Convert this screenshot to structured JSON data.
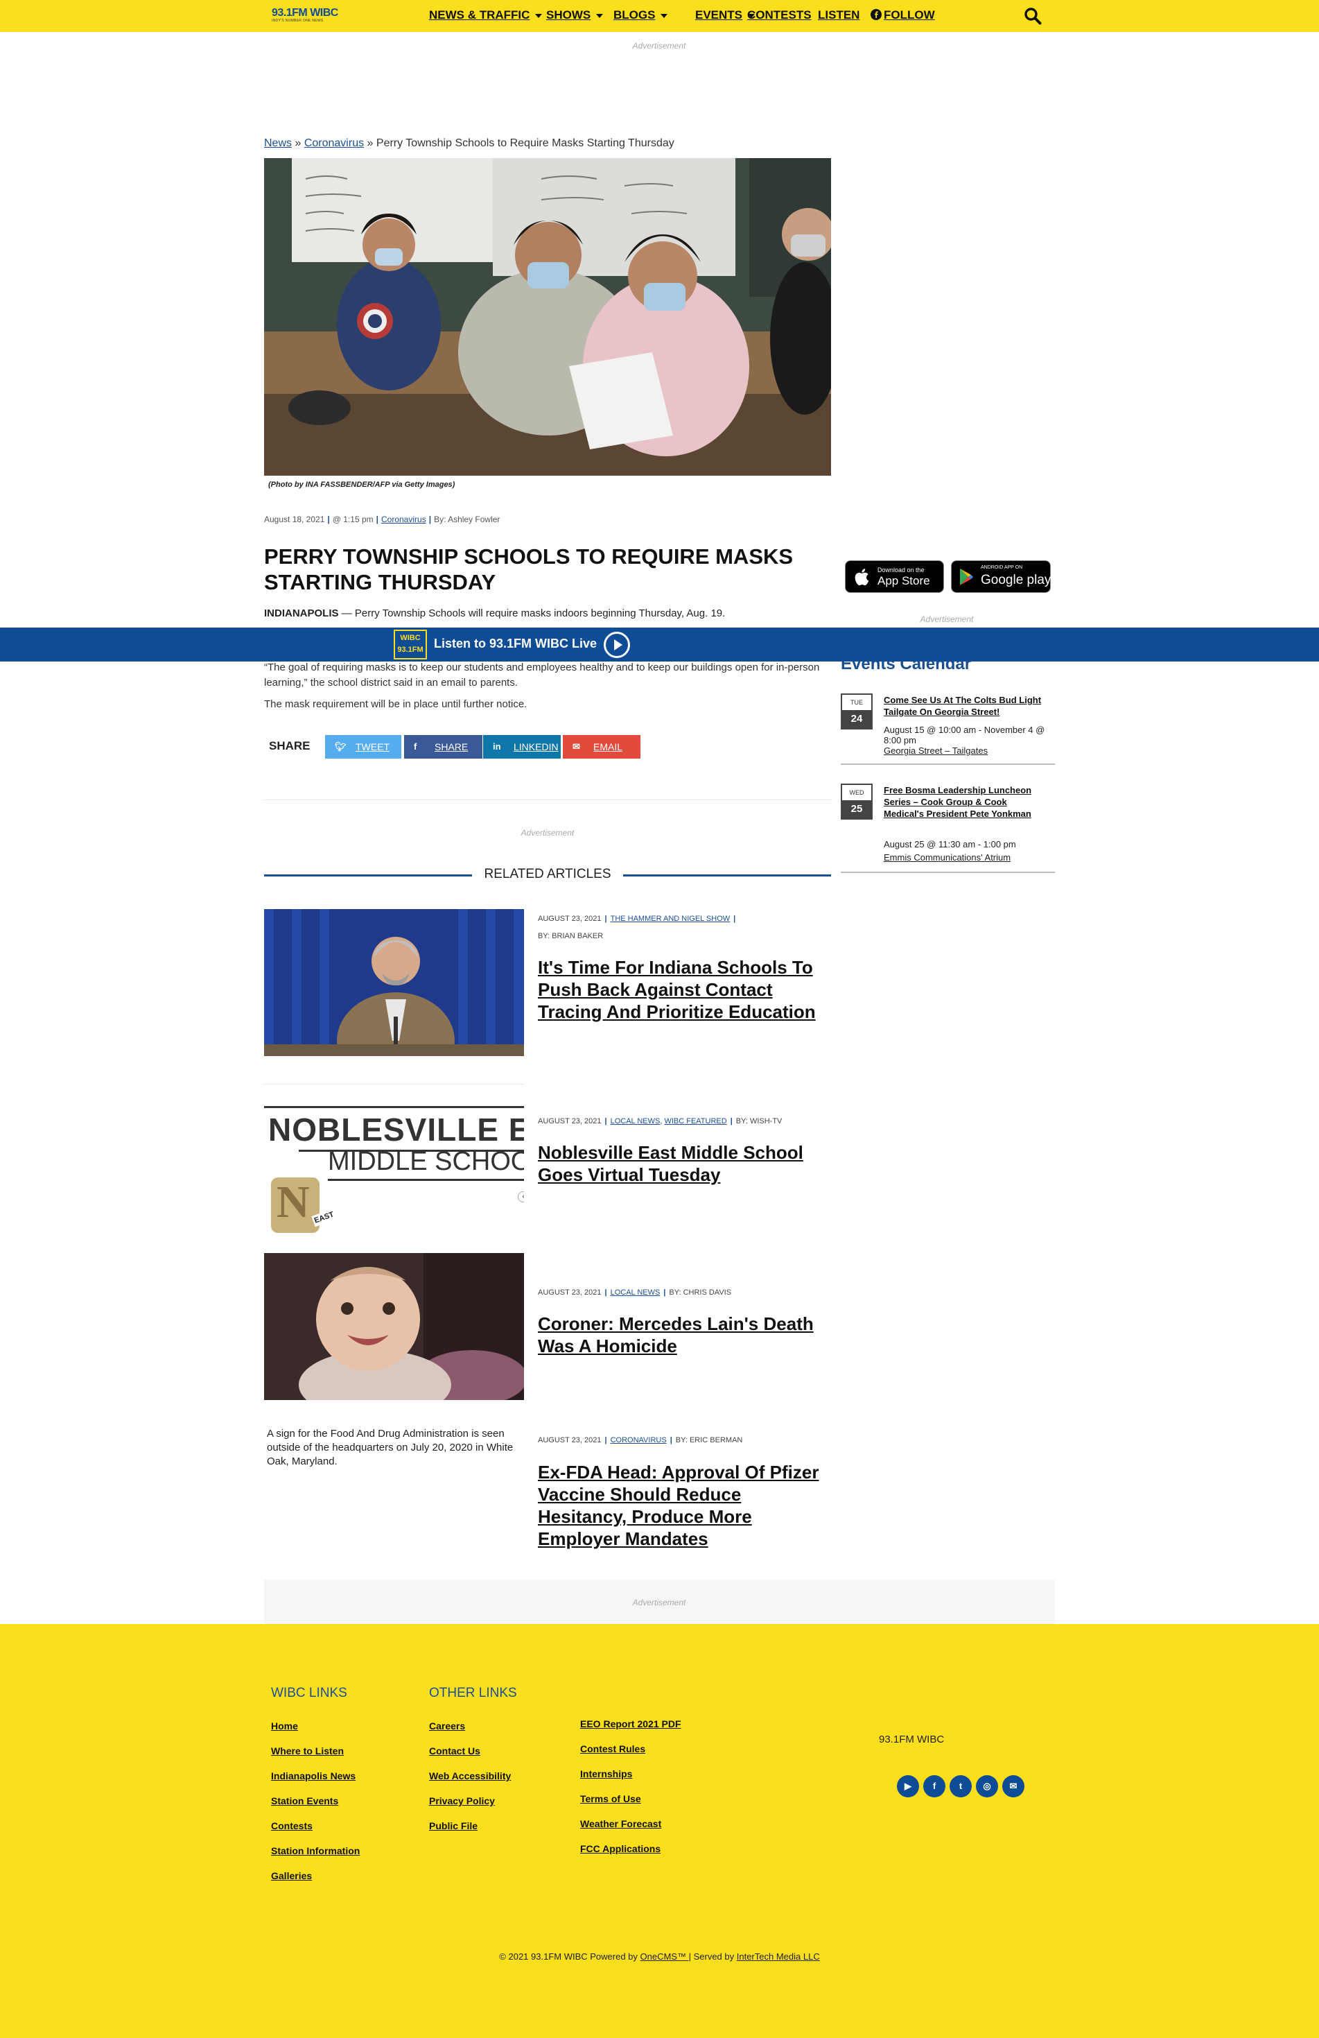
{
  "colors": {
    "brand_yellow": "#fbde1c",
    "brand_blue": "#0e4c96",
    "link_blue": "#1b4f93",
    "tweet": "#55acee",
    "share": "#3b5998",
    "linkedin": "#0e76a8",
    "email": "#e24b3c"
  },
  "header": {
    "logo_text": "93.1FM WIBC",
    "logo_tagline": "Indy's Number One News",
    "nav": [
      {
        "label": "NEWS & TRAFFIC",
        "dropdown": true
      },
      {
        "label": "SHOWS",
        "dropdown": true
      },
      {
        "label": "BLOGS",
        "dropdown": true
      },
      {
        "label": "EVENTS",
        "dropdown": true
      },
      {
        "label": "CONTESTS",
        "dropdown": false
      },
      {
        "label": "LISTEN",
        "dropdown": false
      },
      {
        "label": "FOLLOW",
        "dropdown": false,
        "icon": "facebook-icon"
      }
    ],
    "search_icon": "search-icon"
  },
  "ads": {
    "label": "Advertisement"
  },
  "breadcrumb": {
    "items": [
      "News",
      "Coronavirus"
    ],
    "current": "Perry Township Schools to Require Masks Starting Thursday",
    "separator": "»"
  },
  "article": {
    "photo_credit": "(Photo by INA FASSBENDER/AFP via Getty Images)",
    "date": "August 18, 2021",
    "time": "@ 1:15 pm",
    "category": "Coronavirus",
    "byline": "By: Ashley Fowler",
    "title": "PERRY TOWNSHIP SCHOOLS TO REQUIRE MASKS STARTING THURSDAY",
    "dateline": "INDIANAPOLIS",
    "lead": "— Perry Township Schools will require masks indoors beginning Thursday, Aug. 19.",
    "paragraph2": "“The goal of requiring masks is to keep our students and employees healthy and to keep our buildings open for in-person learning,” the school district said in an email to parents.",
    "paragraph3": "The mask requirement will be in place until further notice."
  },
  "share": {
    "label": "SHARE",
    "buttons": [
      {
        "label": "TWEET",
        "icon": "twitter-icon"
      },
      {
        "label": "SHARE",
        "icon": "facebook-icon"
      },
      {
        "label": "LINKEDIN",
        "icon": "linkedin-icon"
      },
      {
        "label": "EMAIL",
        "icon": "email-icon"
      }
    ]
  },
  "app_badges": {
    "appstore": {
      "small": "Download on the",
      "big": "App Store"
    },
    "googleplay": {
      "small": "ANDROID APP ON",
      "big": "Google play"
    }
  },
  "listen_bar": {
    "logo": "WIBC 93.1FM",
    "label": "Listen to 93.1FM WIBC Live"
  },
  "events": {
    "title": "Events Calendar",
    "items": [
      {
        "dow": "TUE",
        "day": "24",
        "name": "Come See Us At The Colts Bud Light Tailgate On Georgia Street!",
        "time": "August 15 @ 10:00 am - November 4 @ 8:00 pm",
        "location": "Georgia Street – Tailgates"
      },
      {
        "dow": "WED",
        "day": "25",
        "name": "Free Bosma Leadership Luncheon Series – Cook Group & Cook Medical's President Pete Yonkman",
        "time": "August 25 @ 11:30 am - 1:00 pm",
        "location": "Emmis Communications' Atrium"
      }
    ]
  },
  "related": {
    "heading": "RELATED ARTICLES",
    "articles": [
      {
        "date": "AUGUST 23, 2021",
        "categories": [
          "THE HAMMER AND NIGEL SHOW"
        ],
        "byline": "BY: BRIAN BAKER",
        "title": "It's Time For Indiana Schools To Push Back Against Contact Tracing And Prioritize Education"
      },
      {
        "date": "AUGUST 23, 2021",
        "categories": [
          "LOCAL NEWS",
          "WIBC FEATURED"
        ],
        "byline": "BY: WISH-TV",
        "title": "Noblesville East Middle School Goes Virtual Tuesday",
        "image_text_1": "NOBLESVILLE EA",
        "image_text_2": "MIDDLE SCHOOL",
        "image_badge": "N",
        "image_badge_sub": "EAST"
      },
      {
        "date": "AUGUST 23, 2021",
        "categories": [
          "LOCAL NEWS"
        ],
        "byline": "BY: CHRIS DAVIS",
        "title": "Coroner: Mercedes Lain's Death Was A Homicide"
      },
      {
        "date": "AUGUST 23, 2021",
        "categories": [
          "CORONAVIRUS"
        ],
        "byline": "BY: ERIC BERMAN",
        "title": "Ex-FDA Head: Approval Of Pfizer Vaccine Should Reduce Hesitancy, Produce More Employer Mandates",
        "image_caption": "A sign for the Food And Drug Administration is seen outside of the headquarters on July 20, 2020 in White Oak, Maryland."
      }
    ]
  },
  "footer": {
    "wibc_links_title": "WIBC LINKS",
    "wibc_links": [
      "Home",
      "Where to Listen",
      "Indianapolis News",
      "Station Events",
      "Contests",
      "Station Information",
      "Galleries"
    ],
    "other_links_title": "OTHER LINKS",
    "other_links": [
      "Careers",
      "Contact Us",
      "Web Accessibility",
      "Privacy Policy",
      "Public File"
    ],
    "more_links": [
      "EEO Report 2021 PDF",
      "Contest Rules",
      "Internships",
      "Terms of Use",
      "Weather Forecast",
      "FCC Applications"
    ],
    "station_name": "93.1FM WIBC",
    "social": [
      "youtube-icon",
      "facebook-icon",
      "twitter-icon",
      "instagram-icon",
      "email-icon"
    ],
    "copyright_pre": "© 2021 93.1FM WIBC Powered by ",
    "copyright_link1": "OneCMS™ |",
    "copyright_mid": " Served by ",
    "copyright_link2": "InterTech Media LLC"
  }
}
